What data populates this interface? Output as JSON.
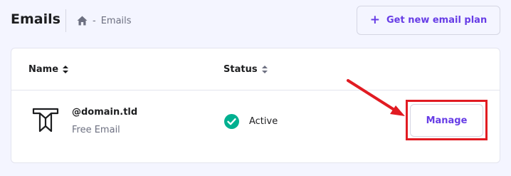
{
  "header": {
    "title": "Emails",
    "breadcrumb_separator": "-",
    "breadcrumb_current": "Emails",
    "new_plan_plus": "+",
    "new_plan_label": "Get new email plan"
  },
  "table": {
    "columns": [
      {
        "label": "Name",
        "sortable": true
      },
      {
        "label": "Status",
        "sortable": true
      }
    ],
    "rows": [
      {
        "icon": "email-plan-icon",
        "domain": "@domain.tld",
        "plan": "Free Email",
        "status": "Active",
        "status_icon": "check-circle-icon",
        "action": "Manage"
      }
    ]
  },
  "colors": {
    "accent": "#673de6",
    "status_active": "#00b090",
    "annotation": "#e11b22",
    "background": "#f4f5ff"
  },
  "annotation": {
    "type": "arrow-and-box",
    "target": "manage-button"
  }
}
